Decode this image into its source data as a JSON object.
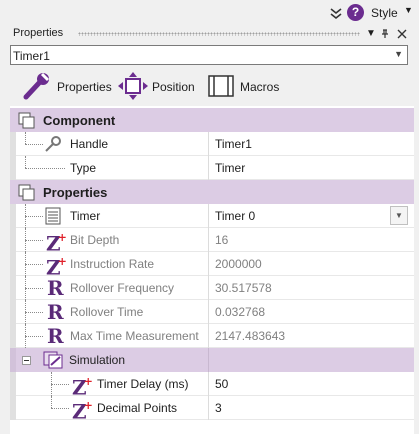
{
  "topbar": {
    "style_label": "Style"
  },
  "panel": {
    "title": "Properties",
    "dropdown_icon": "▾",
    "pin_icon": "📌",
    "close_icon": "✕"
  },
  "object_selector": {
    "value": "Timer1"
  },
  "tabs": [
    {
      "label": "Properties",
      "icon": "wrench-icon"
    },
    {
      "label": "Position",
      "icon": "move-icon"
    },
    {
      "label": "Macros",
      "icon": "macro-icon"
    }
  ],
  "grid": {
    "component": {
      "label": "Component",
      "rows": [
        {
          "name": "Handle",
          "value": "Timer1"
        },
        {
          "name": "Type",
          "value": "Timer"
        }
      ]
    },
    "properties": {
      "label": "Properties",
      "rows": [
        {
          "name": "Timer",
          "value": "Timer 0"
        },
        {
          "name": "Bit Depth",
          "value": "16"
        },
        {
          "name": "Instruction Rate",
          "value": "2000000"
        },
        {
          "name": "Rollover Frequency",
          "value": "30.517578"
        },
        {
          "name": "Rollover Time",
          "value": "0.032768"
        },
        {
          "name": "Max Time Measurement",
          "value": "2147.483643"
        }
      ]
    },
    "simulation": {
      "label": "Simulation",
      "rows": [
        {
          "name": "Timer Delay (ms)",
          "value": "50"
        },
        {
          "name": "Decimal Points",
          "value": "3"
        }
      ]
    }
  },
  "colors": {
    "accent": "#6b2c8f",
    "category_bg": "#dccce4",
    "readonly_text": "#808080"
  }
}
